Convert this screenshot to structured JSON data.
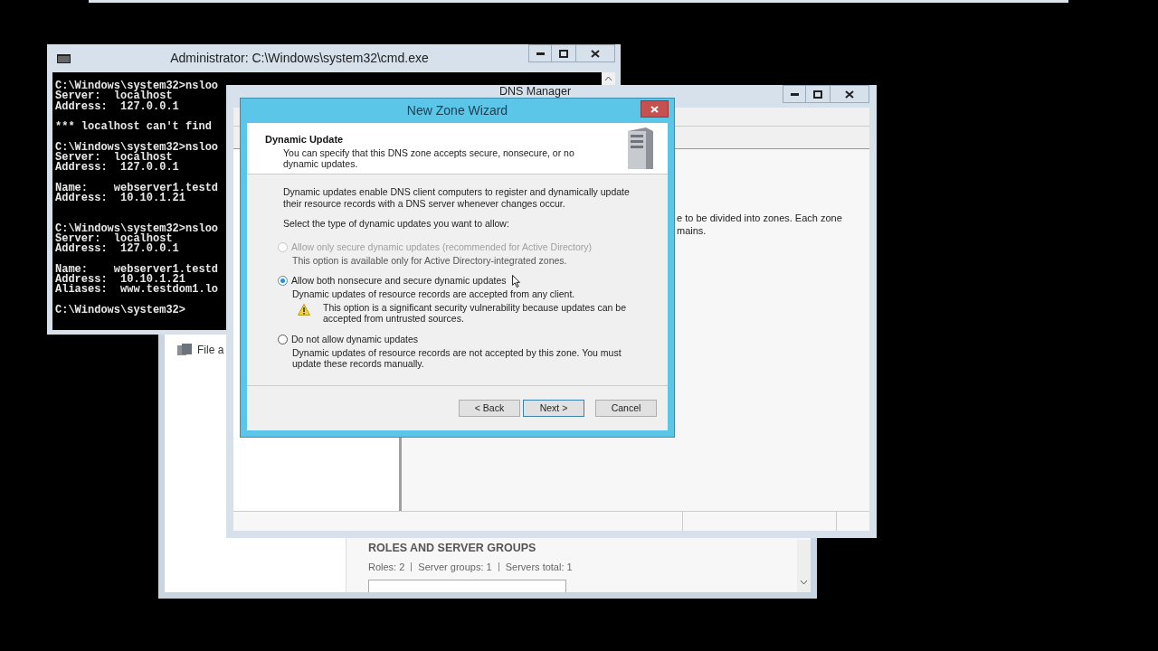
{
  "server_manager": {
    "nav_item": "File a",
    "section_title": "ROLES AND SERVER GROUPS",
    "stats": [
      "Roles: 2",
      "Server groups: 1",
      "Servers total: 1"
    ]
  },
  "cmd_window": {
    "title": "Administrator: C:\\Windows\\system32\\cmd.exe",
    "lines": [
      {
        "kind": "text",
        "text": "C:\\Windows\\system32>nsloo"
      },
      {
        "kind": "text",
        "text": "Server:  localhost"
      },
      {
        "kind": "text",
        "text": "Address:  127.0.0.1"
      },
      {
        "kind": "blank"
      },
      {
        "kind": "text",
        "text": "*** localhost can't find"
      },
      {
        "kind": "blank"
      },
      {
        "kind": "text",
        "text": "C:\\Windows\\system32>nsloo"
      },
      {
        "kind": "text",
        "text": "Server:  localhost"
      },
      {
        "kind": "text",
        "text": "Address:  127.0.0.1"
      },
      {
        "kind": "blank"
      },
      {
        "kind": "text",
        "text": "Name:    webserver1.testd"
      },
      {
        "kind": "text",
        "text": "Address:  10.10.1.21"
      },
      {
        "kind": "blank"
      },
      {
        "kind": "blank"
      },
      {
        "kind": "text",
        "text": "C:\\Windows\\system32>nsloo"
      },
      {
        "kind": "text",
        "text": "Server:  localhost"
      },
      {
        "kind": "text",
        "text": "Address:  127.0.0.1"
      },
      {
        "kind": "blank"
      },
      {
        "kind": "text",
        "text": "Name:    webserver1.testd"
      },
      {
        "kind": "text",
        "text": "Address:  10.10.1.21"
      },
      {
        "kind": "text",
        "text": "Aliases:  www.testdom1.lo"
      },
      {
        "kind": "blank"
      },
      {
        "kind": "text",
        "text": "C:\\Windows\\system32>"
      }
    ]
  },
  "dns_manager": {
    "title": "DNS Manager",
    "description_lines": [
      "e to be divided into zones. Each zone",
      "mains."
    ]
  },
  "wizard": {
    "title": "New Zone Wizard",
    "header": {
      "title": "Dynamic Update",
      "description": "You can specify that this DNS zone accepts secure, nonsecure, or no dynamic updates."
    },
    "intro": "Dynamic updates enable DNS client computers to register and dynamically update their resource records with a DNS server whenever changes occur.",
    "prompt": "Select the type of dynamic updates you want to allow:",
    "options": [
      {
        "label": "Allow only secure dynamic updates (recommended for Active Directory)",
        "description": "This option is available only for Active Directory-integrated zones.",
        "selected": false,
        "disabled": true
      },
      {
        "label": "Allow both nonsecure and secure dynamic updates",
        "description": "Dynamic updates of resource records are accepted from any client.",
        "warning": "This option is a significant security vulnerability because updates can be accepted from untrusted sources.",
        "selected": true,
        "disabled": false
      },
      {
        "label": "Do not allow dynamic updates",
        "description": "Dynamic updates of resource records are not accepted by this zone. You must update these records manually.",
        "selected": false,
        "disabled": false
      }
    ],
    "buttons": [
      {
        "label": "< Back",
        "default": false
      },
      {
        "label": "Next >",
        "default": true
      },
      {
        "label": "Cancel",
        "default": false
      }
    ]
  }
}
